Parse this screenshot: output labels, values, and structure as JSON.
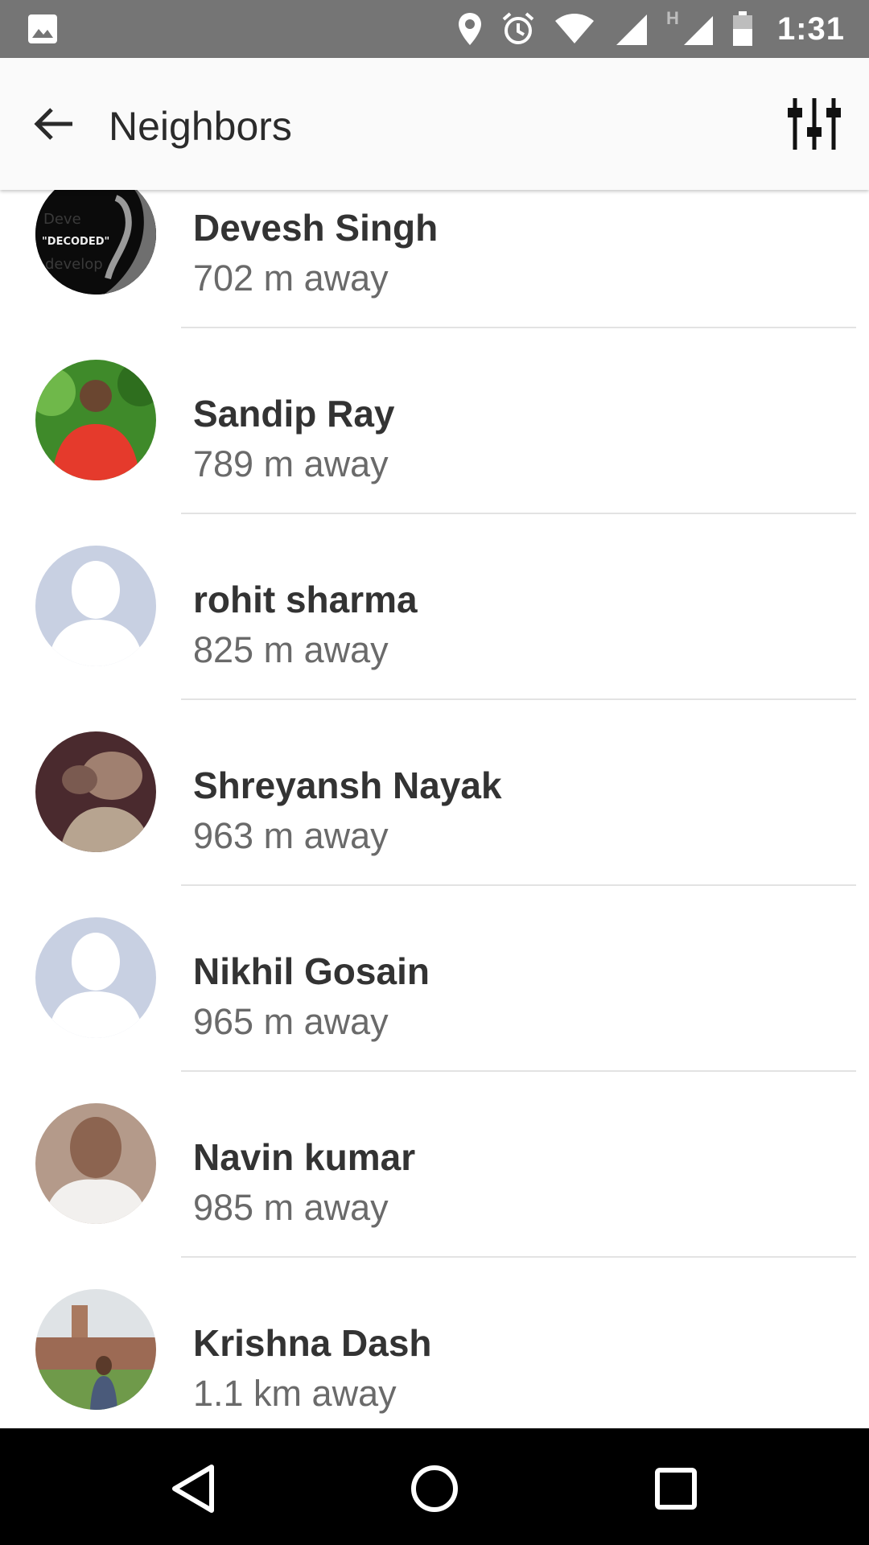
{
  "status_bar": {
    "time": "1:31",
    "network_label": "H",
    "icons": [
      "image-icon",
      "location-icon",
      "alarm-icon",
      "wifi-icon",
      "signal-icon",
      "battery-icon"
    ]
  },
  "app_bar": {
    "title": "Neighbors",
    "back_icon": "arrow-back-icon",
    "filter_icon": "sliders-icon"
  },
  "neighbors": [
    {
      "name": "Devesh Singh",
      "distance": "702 m away",
      "avatar": "photo-dark",
      "avatar_text": "\"DECODED\""
    },
    {
      "name": "Sandip Ray",
      "distance": "789 m away",
      "avatar": "photo-red-shirt"
    },
    {
      "name": "rohit sharma",
      "distance": "825 m away",
      "avatar": "placeholder"
    },
    {
      "name": "Shreyansh Nayak",
      "distance": "963 m away",
      "avatar": "photo-brown"
    },
    {
      "name": "Nikhil Gosain",
      "distance": "965 m away",
      "avatar": "placeholder"
    },
    {
      "name": "Navin kumar",
      "distance": "985 m away",
      "avatar": "photo-white-shirt"
    },
    {
      "name": "Krishna Dash",
      "distance": "1.1 km away",
      "avatar": "photo-campus"
    }
  ],
  "nav_bar": {
    "buttons": [
      "back-triangle-icon",
      "home-circle-icon",
      "recents-square-icon"
    ]
  },
  "colors": {
    "status_bar": "#757575",
    "app_bar": "#fafafa",
    "placeholder_avatar": "#c8d0e2",
    "divider": "#e3e3e3"
  }
}
